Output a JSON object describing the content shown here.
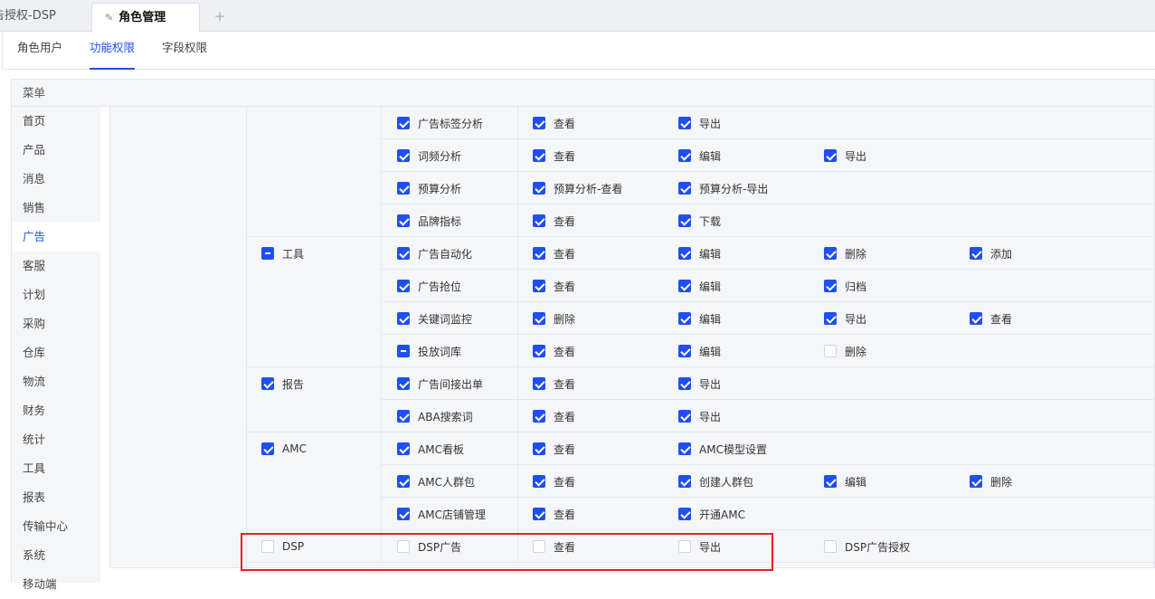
{
  "tabs": [
    {
      "label": "告授权-DSP"
    },
    {
      "label": "角色管理",
      "icon": "pin-icon"
    }
  ],
  "subtabs": [
    {
      "label": "角色用户"
    },
    {
      "label": "功能权限",
      "active": true
    },
    {
      "label": "字段权限"
    }
  ],
  "menu_header": "菜单",
  "sidebar": [
    "首页",
    "产品",
    "消息",
    "销售",
    "广告",
    "客服",
    "计划",
    "采购",
    "仓库",
    "物流",
    "财务",
    "统计",
    "工具",
    "报表",
    "传输中心",
    "系统",
    "移动端"
  ],
  "sidebar_active": "广告",
  "groups": [
    {
      "label": "",
      "state": "none",
      "rows": [
        {
          "label": "广告标签分析",
          "state": "on",
          "actions": [
            [
              "查看",
              "on"
            ],
            [
              "导出",
              "on"
            ]
          ]
        },
        {
          "label": "词频分析",
          "state": "on",
          "actions": [
            [
              "查看",
              "on"
            ],
            [
              "编辑",
              "on"
            ],
            [
              "导出",
              "on"
            ]
          ]
        },
        {
          "label": "预算分析",
          "state": "on",
          "actions": [
            [
              "预算分析-查看",
              "on"
            ],
            [
              "预算分析-导出",
              "on"
            ]
          ]
        },
        {
          "label": "品牌指标",
          "state": "on",
          "actions": [
            [
              "查看",
              "on"
            ],
            [
              "下载",
              "on"
            ]
          ]
        }
      ]
    },
    {
      "label": "工具",
      "state": "half",
      "rows": [
        {
          "label": "广告自动化",
          "state": "on",
          "actions": [
            [
              "查看",
              "on"
            ],
            [
              "编辑",
              "on"
            ],
            [
              "删除",
              "on"
            ],
            [
              "添加",
              "on"
            ]
          ]
        },
        {
          "label": "广告抢位",
          "state": "on",
          "actions": [
            [
              "查看",
              "on"
            ],
            [
              "编辑",
              "on"
            ],
            [
              "归档",
              "on"
            ]
          ]
        },
        {
          "label": "关键词监控",
          "state": "on",
          "actions": [
            [
              "删除",
              "on"
            ],
            [
              "编辑",
              "on"
            ],
            [
              "导出",
              "on"
            ],
            [
              "查看",
              "on"
            ]
          ]
        },
        {
          "label": "投放词库",
          "state": "half",
          "actions": [
            [
              "查看",
              "on"
            ],
            [
              "编辑",
              "on"
            ],
            [
              "删除",
              "off"
            ]
          ]
        }
      ]
    },
    {
      "label": "报告",
      "state": "on",
      "rows": [
        {
          "label": "广告间接出单",
          "state": "on",
          "actions": [
            [
              "查看",
              "on"
            ],
            [
              "导出",
              "on"
            ]
          ]
        },
        {
          "label": "ABA搜索词",
          "state": "on",
          "actions": [
            [
              "查看",
              "on"
            ],
            [
              "导出",
              "on"
            ]
          ]
        }
      ]
    },
    {
      "label": "AMC",
      "state": "on",
      "rows": [
        {
          "label": "AMC看板",
          "state": "on",
          "actions": [
            [
              "查看",
              "on"
            ],
            [
              "AMC模型设置",
              "on"
            ]
          ]
        },
        {
          "label": "AMC人群包",
          "state": "on",
          "actions": [
            [
              "查看",
              "on"
            ],
            [
              "创建人群包",
              "on"
            ],
            [
              "编辑",
              "on"
            ],
            [
              "删除",
              "on"
            ]
          ]
        },
        {
          "label": "AMC店铺管理",
          "state": "on",
          "actions": [
            [
              "查看",
              "on"
            ],
            [
              "开通AMC",
              "on"
            ]
          ]
        }
      ]
    },
    {
      "label": "DSP",
      "state": "off",
      "highlighted": true,
      "rows": [
        {
          "label": "DSP广告",
          "state": "off",
          "actions": [
            [
              "查看",
              "off"
            ],
            [
              "导出",
              "off"
            ],
            [
              "DSP广告授权",
              "off"
            ]
          ]
        }
      ]
    }
  ],
  "colors": {
    "accent": "#1f4ff0",
    "highlight": "#e5202b"
  }
}
